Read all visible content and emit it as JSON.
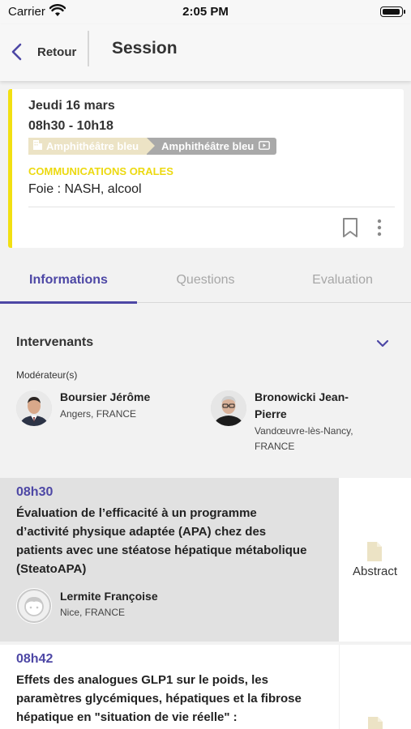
{
  "status_bar": {
    "carrier": "Carrier",
    "time": "2:05 PM"
  },
  "nav": {
    "back_label": "Retour",
    "title": "Session"
  },
  "session": {
    "date": "Jeudi 16 mars",
    "hours": "08h30 - 10h18",
    "room_primary": "Amphithéâtre bleu",
    "room_secondary": "Amphithéâtre bleu",
    "category": "COMMUNICATIONS ORALES",
    "topic": "Foie : NASH, alcool",
    "accent_color": "#f2e012"
  },
  "tabs": [
    {
      "label": "Informations",
      "active": true
    },
    {
      "label": "Questions",
      "active": false
    },
    {
      "label": "Evaluation",
      "active": false
    }
  ],
  "intervenants": {
    "title": "Intervenants",
    "moderator_label": "Modérateur(s)",
    "moderators": [
      {
        "name": "Boursier Jérôme",
        "location": "Angers, FRANCE"
      },
      {
        "name_line1": "Bronowicki Jean-",
        "name_line2": "Pierre",
        "location_line1": "Vandœuvre-lès-Nancy,",
        "location_line2": "FRANCE"
      }
    ]
  },
  "talks": [
    {
      "time": "08h30",
      "title": "Évaluation de l’efficacité à un programme d’activité physique adaptée (APA) chez des patients avec une stéatose hépatique métabolique (SteatoAPA)",
      "speaker": "Lermite Françoise",
      "location": "Nice, FRANCE",
      "abstract_label": "Abstract"
    },
    {
      "time": "08h42",
      "title": "Effets des analogues GLP1 sur le poids, les paramètres glycémiques, hépatiques et la fibrose hépatique en \"situation de vie réelle\" :"
    }
  ],
  "colors": {
    "brand": "#4d47a5",
    "category": "#ecd910",
    "highlight_row": "#e1e1e1"
  }
}
